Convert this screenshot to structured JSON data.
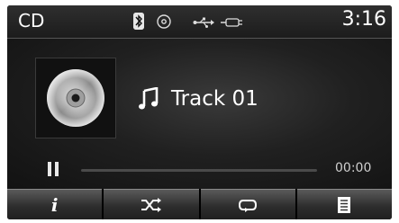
{
  "status": {
    "source": "CD",
    "clock": "3:16",
    "icons": [
      "bluetooth-icon",
      "disc-indicator-icon",
      "usb-icon",
      "aux-plug-icon"
    ]
  },
  "player": {
    "track_title": "Track 01",
    "elapsed": "00:00",
    "progress_fraction": 0,
    "state": "paused"
  },
  "softkeys": [
    {
      "name": "info",
      "icon": "info-icon"
    },
    {
      "name": "shuffle",
      "icon": "shuffle-icon"
    },
    {
      "name": "repeat",
      "icon": "repeat-icon"
    },
    {
      "name": "list",
      "icon": "list-icon"
    }
  ],
  "colors": {
    "background": "#000000",
    "text": "#ffffff",
    "progress_track": "#4a4a4a"
  }
}
